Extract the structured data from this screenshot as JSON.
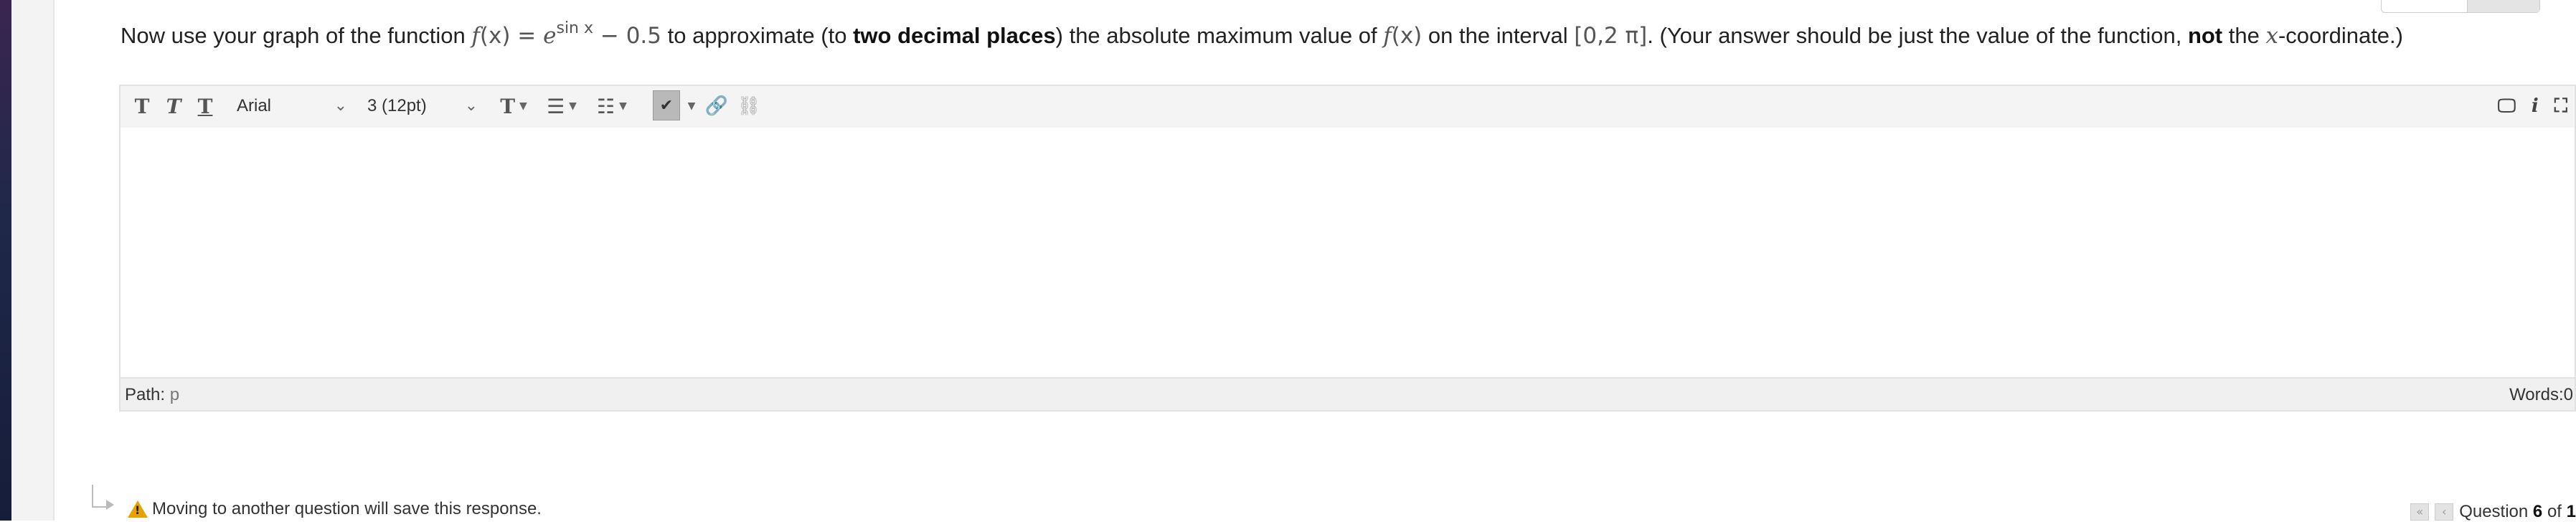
{
  "question": {
    "p1": "Now use your graph of the function ",
    "fx": "f",
    "paren_x": "(x)",
    "eq": " = ",
    "e": "e",
    "exp": "sin x",
    "minus": " − 0.5",
    "p2": " to approximate (to ",
    "bold1": "two decimal places",
    "p3": ") the absolute maximum value of ",
    "fx2": "f",
    "paren_x2": "(x)",
    "p4": " on the interval ",
    "interval": "[0,2 π]",
    "p5": ". (Your answer should be just the value of the function, ",
    "bold2": "not",
    "p6": " the ",
    "xvar": "x",
    "p7": "-coordinate.)"
  },
  "toolbar": {
    "bold_label": "T",
    "italic_label": "T",
    "underline_label": "T",
    "font_family": "Arial",
    "font_size": "3 (12pt)",
    "text_color_label": "T",
    "bullets_icon": "☰",
    "numbered_icon": "☷",
    "spell_icon": "✔",
    "link_icon": "🔗",
    "unlink_icon": "⛓",
    "preview_icon": "🖵",
    "info_icon": "i",
    "fullscreen_icon": "⛶"
  },
  "status": {
    "path_label": "Path:",
    "path_value": "p",
    "words": "Words:0"
  },
  "footer": {
    "save_note": "Moving to another question will save this response.",
    "first_icon": "«",
    "prev_icon": "‹",
    "question_label": "Question",
    "question_number": "6",
    "of_label": "of",
    "total": "1"
  }
}
